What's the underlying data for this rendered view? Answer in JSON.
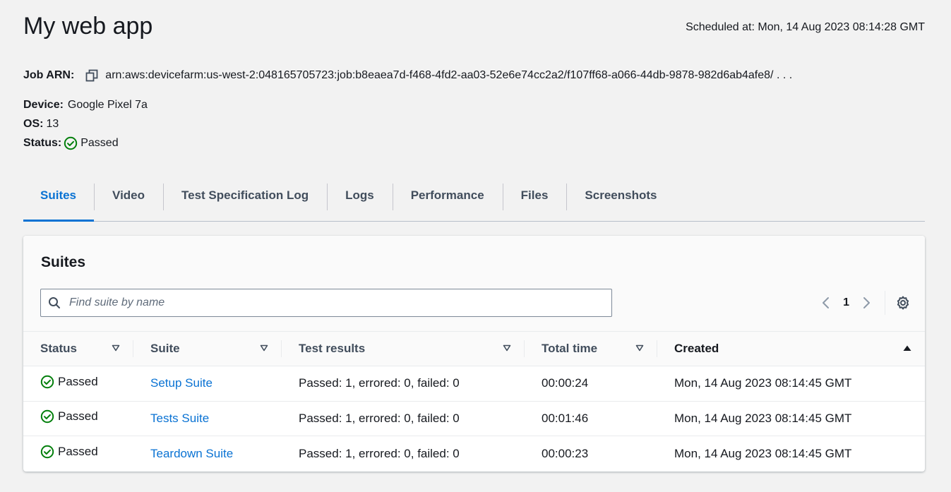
{
  "header": {
    "title": "My web app",
    "scheduled_label": "Scheduled at:",
    "scheduled_value": "Mon, 14 Aug 2023 08:14:28 GMT"
  },
  "details": {
    "arn_label": "Job ARN:",
    "arn_value": "arn:aws:devicefarm:us-west-2:048165705723:job:b8eaea7d-f468-4fd2-aa03-52e6e74cc2a2/f107ff68-a066-44db-9878-982d6ab4afe8/ . . .",
    "device_label": "Device:",
    "device_value": "Google Pixel 7a",
    "os_label": "OS:",
    "os_value": "13",
    "status_label": "Status:",
    "status_value": "Passed"
  },
  "tabs": [
    {
      "label": "Suites",
      "active": true
    },
    {
      "label": "Video"
    },
    {
      "label": "Test Specification Log"
    },
    {
      "label": "Logs"
    },
    {
      "label": "Performance"
    },
    {
      "label": "Files"
    },
    {
      "label": "Screenshots"
    }
  ],
  "panel": {
    "title": "Suites",
    "search_placeholder": "Find suite by name",
    "page": "1"
  },
  "table": {
    "columns": [
      "Status",
      "Suite",
      "Test results",
      "Total time",
      "Created"
    ],
    "rows": [
      {
        "status": "Passed",
        "suite": "Setup Suite",
        "results": "Passed: 1, errored: 0, failed: 0",
        "time": "00:00:24",
        "created": "Mon, 14 Aug 2023 08:14:45 GMT"
      },
      {
        "status": "Passed",
        "suite": "Tests Suite",
        "results": "Passed: 1, errored: 0, failed: 0",
        "time": "00:01:46",
        "created": "Mon, 14 Aug 2023 08:14:45 GMT"
      },
      {
        "status": "Passed",
        "suite": "Teardown Suite",
        "results": "Passed: 1, errored: 0, failed: 0",
        "time": "00:00:23",
        "created": "Mon, 14 Aug 2023 08:14:45 GMT"
      }
    ]
  },
  "colors": {
    "accent": "#0972d3",
    "success": "#037f0c",
    "background": "#f2f2f2"
  }
}
